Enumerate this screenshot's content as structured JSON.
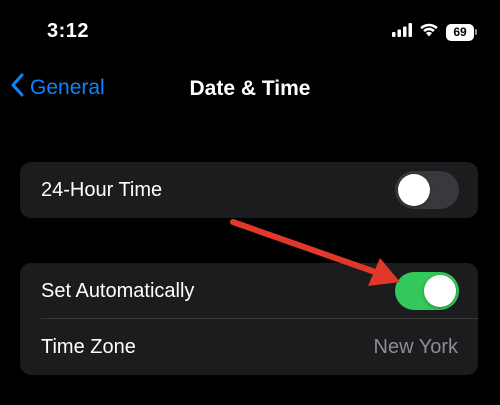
{
  "status_bar": {
    "time": "3:12",
    "battery_level": "69",
    "icons": [
      "signal-icon",
      "wifi-icon",
      "battery-icon"
    ]
  },
  "nav": {
    "back_label": "General",
    "title": "Date & Time"
  },
  "settings": {
    "hour24": {
      "label": "24-Hour Time",
      "enabled": false
    },
    "set_automatically": {
      "label": "Set Automatically",
      "enabled": true
    },
    "time_zone": {
      "label": "Time Zone",
      "value": "New York"
    }
  },
  "colors": {
    "accent": "#0a84ff",
    "toggle_on": "#34c759",
    "toggle_off": "#39393d",
    "group_bg": "#1c1c1e",
    "secondary_text": "#8d8d93",
    "annotation_arrow": "#e2382c"
  }
}
